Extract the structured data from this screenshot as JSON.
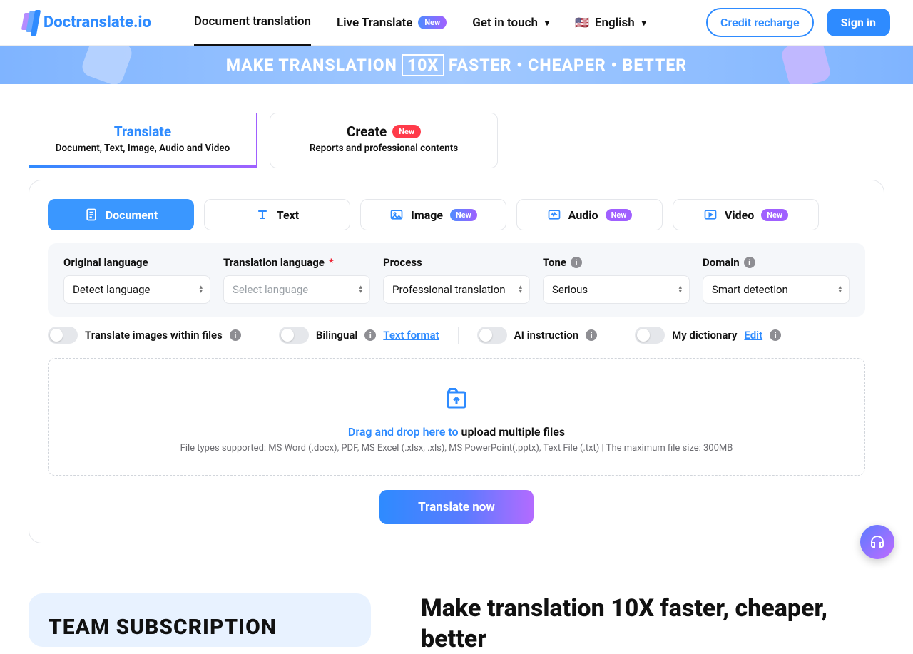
{
  "brand": "Doctranslate.io",
  "nav": {
    "items": [
      {
        "label": "Document translation",
        "badge": null,
        "active": true
      },
      {
        "label": "Live Translate",
        "badge": "New",
        "active": false
      },
      {
        "label": "Get in touch",
        "badge": null,
        "active": false
      }
    ],
    "language": "English",
    "credit": "Credit recharge",
    "signin": "Sign in"
  },
  "hero": {
    "pre": "MAKE TRANSLATION",
    "boxed": "10X",
    "post": "FASTER • CHEAPER • BETTER"
  },
  "modes": [
    {
      "title": "Translate",
      "sub": "Document, Text, Image, Audio and Video",
      "badge": null,
      "active": true
    },
    {
      "title": "Create",
      "sub": "Reports and professional contents",
      "badge": "New",
      "active": false
    }
  ],
  "type_tabs": [
    {
      "label": "Document",
      "badge": null,
      "active": true
    },
    {
      "label": "Text",
      "badge": null,
      "active": false
    },
    {
      "label": "Image",
      "badge": "New",
      "active": false
    },
    {
      "label": "Audio",
      "badge": "New",
      "active": false
    },
    {
      "label": "Video",
      "badge": "New",
      "active": false
    }
  ],
  "options": {
    "original": {
      "label": "Original language",
      "value": "Detect language"
    },
    "translation": {
      "label": "Translation language",
      "placeholder": "Select language"
    },
    "process": {
      "label": "Process",
      "value": "Professional translation"
    },
    "tone": {
      "label": "Tone",
      "value": "Serious"
    },
    "domain": {
      "label": "Domain",
      "value": "Smart detection"
    }
  },
  "toggles": {
    "images": "Translate images within files",
    "bilingual": "Bilingual",
    "text_format": "Text format",
    "ai_instruction": "AI instruction",
    "dictionary": "My dictionary",
    "edit": "Edit"
  },
  "dropzone": {
    "lead": "Drag and drop here to",
    "rest": " upload multiple files",
    "sub": "File types supported: MS Word (.docx), PDF, MS Excel (.xlsx, .xls), MS PowerPoint(.pptx), Text File (.txt) | The maximum file size: 300MB"
  },
  "cta": "Translate now",
  "bottom": {
    "team": "TEAM SUBSCRIPTION",
    "headline": "Make translation 10X faster, cheaper, better"
  }
}
